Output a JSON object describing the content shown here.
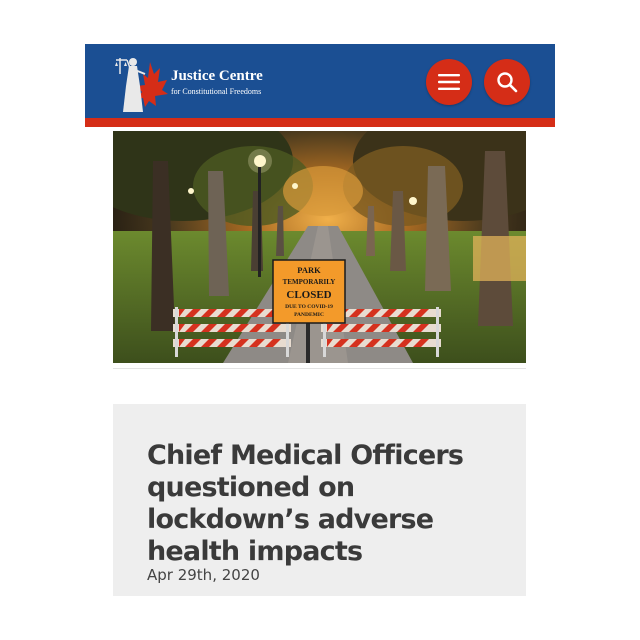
{
  "header": {
    "brand_title": "Justice Centre",
    "brand_subtitle": "for Constitutional Freedoms",
    "menu_icon": "hamburger-menu-icon",
    "search_icon": "search-icon",
    "colors": {
      "primary": "#1b4f93",
      "accent": "#d52d17"
    }
  },
  "hero": {
    "sign_lines": [
      "PARK",
      "TEMPORARILY",
      "CLOSED",
      "DUE TO COVID-19",
      "PANDEMIC"
    ]
  },
  "article": {
    "headline": "Chief Medical Officers questioned on lockdown’s adverse health impacts",
    "date": "Apr 29th, 2020"
  }
}
